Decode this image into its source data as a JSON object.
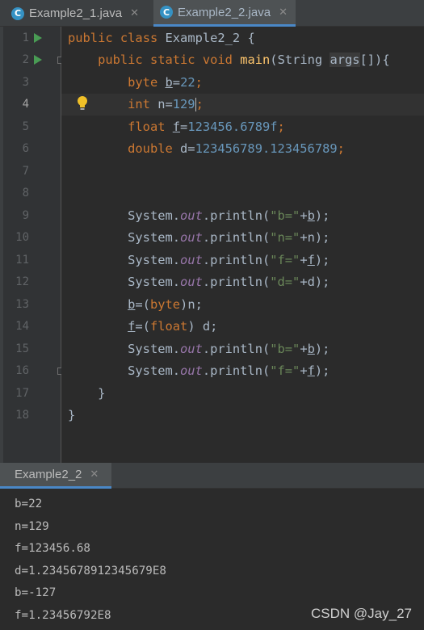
{
  "tabs": [
    {
      "label": "Example2_1.java",
      "icon": "java-class-icon",
      "active": false
    },
    {
      "label": "Example2_2.java",
      "icon": "java-class-icon",
      "active": true
    }
  ],
  "editor": {
    "line_numbers": [
      "1",
      "2",
      "3",
      "4",
      "5",
      "6",
      "7",
      "8",
      "9",
      "10",
      "11",
      "12",
      "13",
      "14",
      "15",
      "16",
      "17",
      "18"
    ],
    "current_line": 4,
    "code": {
      "l1": {
        "kw1": "public",
        "kw2": "class",
        "name": "Example2_2",
        "brace": " {"
      },
      "l2": {
        "kw1": "public",
        "kw2": "static",
        "kw3": "void",
        "fn": "main",
        "p1": "(String ",
        "param": "args",
        "p2": "[]){"
      },
      "l3": {
        "kw": "byte",
        "sp": " ",
        "var": "b",
        "eq": "=",
        "num": "22",
        "semi": ";"
      },
      "l4": {
        "kw": "int",
        "rest": " n=",
        "num": "129",
        "semi": ";"
      },
      "l5": {
        "kw": "float",
        "sp": " ",
        "var": "f",
        "eq": "=",
        "num": "123456.6789f",
        "semi": ";"
      },
      "l6": {
        "kw": "double",
        "rest": " d=",
        "num": "123456789.123456789",
        "semi": ";"
      },
      "l8": {
        "sys": "System.",
        "fld": "out",
        "call": ".println(",
        "str": "\"b=\"",
        "plus": "+",
        "var": "b",
        "end": ");"
      },
      "l9": {
        "sys": "System.",
        "fld": "out",
        "call": ".println(",
        "str": "\"n=\"",
        "plus": "+n",
        "end": ");"
      },
      "l10": {
        "sys": "System.",
        "fld": "out",
        "call": ".println(",
        "str": "\"f=\"",
        "plus": "+",
        "var": "f",
        "end": ");"
      },
      "l11": {
        "sys": "System.",
        "fld": "out",
        "call": ".println(",
        "str": "\"d=\"",
        "plus": "+d",
        "end": ");"
      },
      "l12": {
        "var": "b",
        "p1": "=(",
        "kw": "byte",
        "p2": ")n;"
      },
      "l13": {
        "var": "f",
        "p1": "=(",
        "kw": "float",
        "p2": ") d;"
      },
      "l14": {
        "sys": "System.",
        "fld": "out",
        "call": ".println(",
        "str": "\"b=\"",
        "plus": "+",
        "var": "b",
        "end": ");"
      },
      "l15": {
        "sys": "System.",
        "fld": "out",
        "call": ".println(",
        "str": "\"f=\"",
        "plus": "+",
        "var": "f",
        "end": ");"
      },
      "l16": {
        "brace": "}"
      },
      "l17": {
        "brace": "}"
      }
    }
  },
  "run_panel": {
    "tab_label": "Example2_2",
    "output": [
      "b=22",
      "n=129",
      "f=123456.68",
      "d=1.2345678912345679E8",
      "b=-127",
      "f=1.23456792E8"
    ]
  },
  "watermark": "CSDN @Jay_27",
  "colors": {
    "keyword": "#cc7832",
    "number": "#6897bb",
    "string": "#6a8759",
    "method": "#ffc66d",
    "field": "#9876aa",
    "background": "#2b2b2b"
  }
}
